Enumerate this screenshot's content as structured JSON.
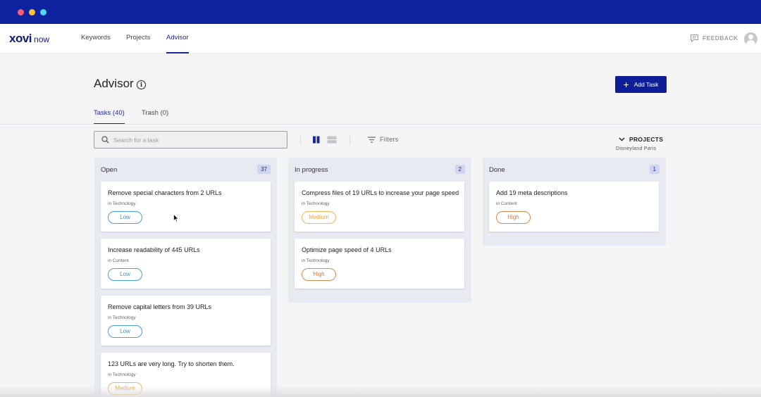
{
  "window": {
    "controls": [
      "close",
      "minimize",
      "maximize"
    ],
    "colors": {
      "titlebar": "#0e22a0",
      "close": "#ff5f6d",
      "minimize": "#ffc234",
      "maximize": "#4fd8ee"
    }
  },
  "navbar": {
    "logo_main": "xovi",
    "logo_sub": "now",
    "links": [
      {
        "label": "Keywords",
        "active": false
      },
      {
        "label": "Projects",
        "active": false
      },
      {
        "label": "Advisor",
        "active": true
      }
    ],
    "feedback_label": "FEEDBACK",
    "feedback_icon": "chat-icon",
    "avatar_icon": "user-avatar-icon"
  },
  "header": {
    "title": "Advisor",
    "info_icon": "info-icon",
    "add_task_label": "Add Task"
  },
  "tabs": [
    {
      "label": "Tasks (40)",
      "active": true
    },
    {
      "label": "Trash (0)",
      "active": false
    }
  ],
  "toolbar": {
    "search_placeholder": "Search for a task",
    "view_modes": [
      "board-view-icon",
      "list-view-icon"
    ],
    "filters_label": "Filters",
    "projects_label": "PROJECTS",
    "project_name": "Disneyland Paris"
  },
  "columns": [
    {
      "title": "Open",
      "count": "37",
      "cards": [
        {
          "title": "Remove special characters from 2 URLs",
          "category": "in Technology",
          "priority": "Low"
        },
        {
          "title": "Increase readability of 445 URLs",
          "category": "in Content",
          "priority": "Low"
        },
        {
          "title": "Remove capital letters from 39 URLs",
          "category": "in Technology",
          "priority": "Low"
        },
        {
          "title": "123 URLs are very long. Try to shorten them.",
          "category": "in Technology",
          "priority": "Medium"
        }
      ]
    },
    {
      "title": "In progress",
      "count": "2",
      "cards": [
        {
          "title": "Compress files of 19 URLs to increase your page speed",
          "category": "in Technology",
          "priority": "Medium"
        },
        {
          "title": "Optimize page speed of 4 URLs",
          "category": "in Technology",
          "priority": "High"
        }
      ]
    },
    {
      "title": "Done",
      "count": "1",
      "cards": [
        {
          "title": "Add 19 meta descriptions",
          "category": "in Content",
          "priority": "High"
        }
      ]
    }
  ],
  "colors": {
    "accent": "#0e1e96",
    "priority_low": "#3b92c8",
    "priority_medium": "#e6a443",
    "priority_high": "#cc7a3a"
  }
}
